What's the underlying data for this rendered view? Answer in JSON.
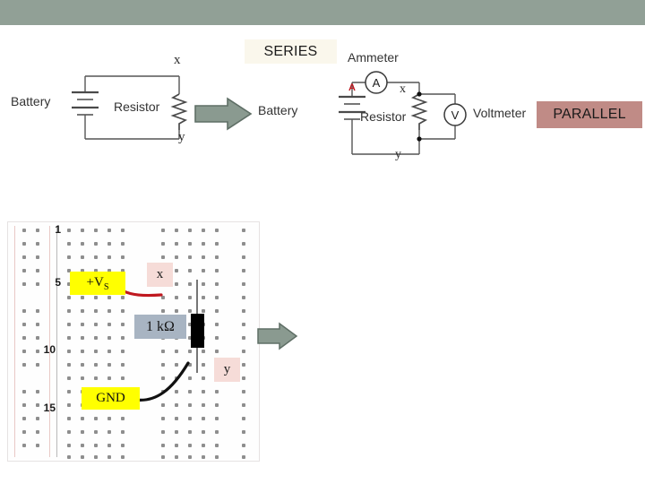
{
  "slide": {
    "banner_color": "#91a096",
    "background_color": "#ffffff"
  },
  "labels": {
    "series": "SERIES",
    "parallel": "PARALLEL",
    "series_bg": "#faf7ec",
    "parallel_bg": "#c08b86"
  },
  "circuit_left": {
    "battery": "Battery",
    "resistor": "Resistor",
    "node_x": "x",
    "node_y": "y"
  },
  "circuit_right": {
    "battery": "Battery",
    "resistor": "Resistor",
    "ammeter_label": "Ammeter",
    "ammeter_symbol": "A",
    "ammeter_red_mark": "A",
    "voltmeter_label": "Voltmeter",
    "voltmeter_symbol": "V",
    "node_x": "x",
    "node_y": "y"
  },
  "breadboard": {
    "row_numbers": [
      "1",
      "5",
      "10",
      "15"
    ],
    "supply_label_prefix": "+V",
    "supply_label_sub": "S",
    "resistor_value": "1 kΩ",
    "ground_label": "GND",
    "node_x": "x",
    "node_y": "y",
    "supply_chip_color": "#ffff00",
    "ground_chip_color": "#ffff00",
    "value_chip_color": "#a8b4c2",
    "node_chip_color": "#f6dcd8",
    "supply_wire_color": "#c0181f",
    "ground_wire_color": "#111111"
  },
  "arrows": {
    "fill": "#8a9a90",
    "stroke": "#5f6f66",
    "top_arrow_name": "transition-arrow-top",
    "bottom_arrow_name": "transition-arrow-bottom"
  }
}
